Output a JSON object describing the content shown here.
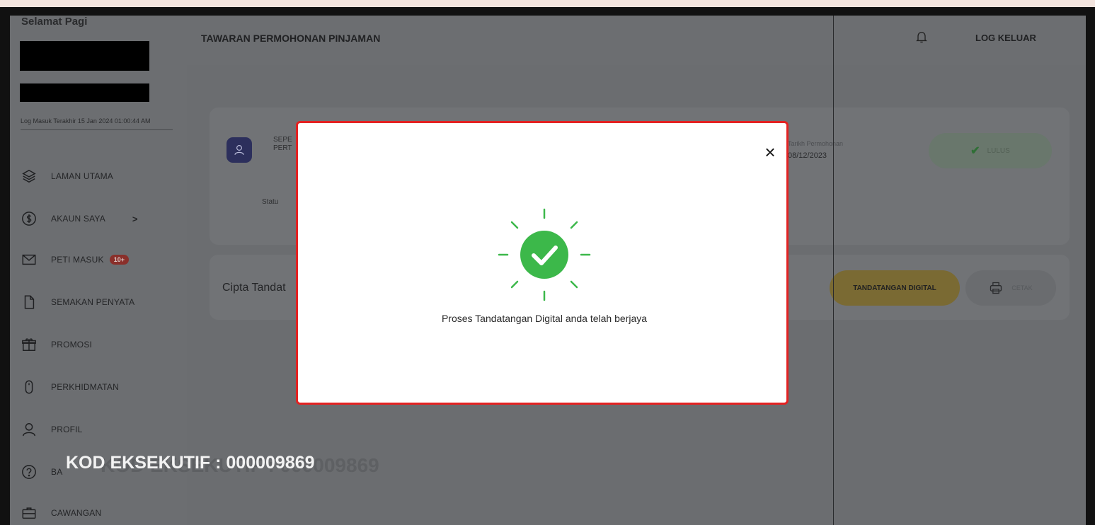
{
  "sidebar": {
    "greeting": "Selamat Pagi",
    "last_login": "Log Masuk Terakhir 15 Jan 2024 01:00:44 AM",
    "items": [
      {
        "label": "LAMAN UTAMA",
        "icon": "layers-icon"
      },
      {
        "label": "AKAUN SAYA",
        "icon": "dollar-circle-icon",
        "chevron": ">"
      },
      {
        "label": "PETI MASUK",
        "icon": "mail-icon",
        "badge": "10+"
      },
      {
        "label": "SEMAKAN PENYATA",
        "icon": "document-icon"
      },
      {
        "label": "PROMOSI",
        "icon": "gift-icon"
      },
      {
        "label": "PERKHIDMATAN",
        "icon": "mouse-icon"
      },
      {
        "label": "PROFIL",
        "icon": "user-icon"
      },
      {
        "label": "BA",
        "icon": "help-circle-icon"
      },
      {
        "label": "CAWANGAN",
        "icon": "briefcase-icon"
      }
    ]
  },
  "header": {
    "title": "TAWARAN PERMOHONAN PINJAMAN",
    "logout": "LOG KELUAR"
  },
  "application_card": {
    "line1": "SEPE",
    "line2": "PERT",
    "status_label": "Statu",
    "date_label": "Tarikh Permohonan",
    "date_value": "08/12/2023",
    "status_badge": "LULUS"
  },
  "signature_card": {
    "title": "Cipta Tandat",
    "digital_button": "TANDATANGAN DIGITAL",
    "print_button": "CETAK"
  },
  "watermark": {
    "text": "KOD EKSEKUTIF : 000009869"
  },
  "modal": {
    "message": "Proses Tandatangan Digital anda telah berjaya",
    "close": "×"
  },
  "colors": {
    "success": "#3cb84a",
    "modal_border": "#e32222",
    "overlay": "#6b6d70"
  }
}
